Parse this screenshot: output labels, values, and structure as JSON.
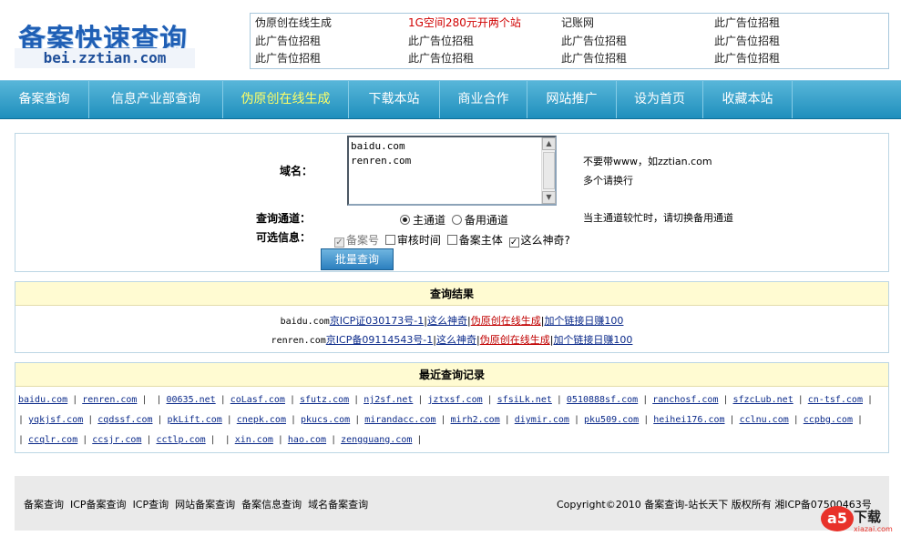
{
  "logo": {
    "title": "备案快速查询",
    "domain": "bei.zztian.com"
  },
  "ads": [
    [
      {
        "text": "伪原创在线生成",
        "red": false
      },
      {
        "text": "1G空间280元开两个站",
        "red": true
      },
      {
        "text": "记账网",
        "red": false
      },
      {
        "text": "此广告位招租",
        "red": false
      }
    ],
    [
      {
        "text": "此广告位招租",
        "red": false
      },
      {
        "text": "此广告位招租",
        "red": false
      },
      {
        "text": "此广告位招租",
        "red": false
      },
      {
        "text": "此广告位招租",
        "red": false
      }
    ],
    [
      {
        "text": "此广告位招租",
        "red": false
      },
      {
        "text": "此广告位招租",
        "red": false
      },
      {
        "text": "此广告位招租",
        "red": false
      },
      {
        "text": "此广告位招租",
        "red": false
      }
    ]
  ],
  "nav": [
    {
      "label": "备案查询",
      "active": false
    },
    {
      "label": "信息产业部查询",
      "active": false
    },
    {
      "label": "伪原创在线生成",
      "active": true
    },
    {
      "label": "下载本站",
      "active": false
    },
    {
      "label": "商业合作",
      "active": false
    },
    {
      "label": "网站推广",
      "active": false
    },
    {
      "label": "设为首页",
      "active": false
    },
    {
      "label": "收藏本站",
      "active": false
    }
  ],
  "form": {
    "domain_label": "域名：",
    "domain_value": "baidu.com\nrenren.com",
    "domain_note_1": "不要带www，如zztian.com",
    "domain_note_2": "多个请换行",
    "channel_label": "查询通道：",
    "channel_main": "主通道",
    "channel_backup": "备用通道",
    "channel_note": "当主通道较忙时，请切换备用通道",
    "options_label": "可选信息：",
    "opt_icp": "备案号",
    "opt_time": "审核时间",
    "opt_owner": "备案主体",
    "opt_magic": "这么神奇?",
    "submit": "批量查询"
  },
  "results": {
    "title": "查询结果",
    "rows": [
      {
        "domain": "baidu.com",
        "icp": "京ICP证030173号-1",
        "magic": "这么神奇",
        "fake": "伪原创在线生成",
        "earn": "加个链接日赚100"
      },
      {
        "domain": "renren.com",
        "icp": "京ICP备09114543号-1",
        "magic": "这么神奇",
        "fake": "伪原创在线生成",
        "earn": "加个链接日赚100"
      }
    ]
  },
  "recent": {
    "title": "最近查询记录",
    "lines": [
      [
        "baidu.com",
        "renren.com",
        "",
        "00635.net",
        "coLasf.com",
        "sfutz.com",
        "nj2sf.net",
        "jztxsf.com",
        "sfsiLk.net",
        "0510888sf.com",
        "ranchosf.com",
        "sfzcLub.net",
        "cn-tsf.com"
      ],
      [
        "yqkjsf.com",
        "cqdssf.com",
        "pkLift.com",
        "cnepk.com",
        "pkucs.com",
        "mirandacc.com",
        "mirh2.com",
        "diymir.com",
        "pku509.com",
        "heihei176.com",
        "cclnu.com",
        "ccpbg.com"
      ],
      [
        "ccqlr.com",
        "ccsjr.com",
        "cctlp.com",
        "",
        "xin.com",
        "hao.com",
        "zengguang.com"
      ]
    ]
  },
  "footer": {
    "links": [
      "备案查询",
      "ICP备案查询",
      "ICP查询",
      "网站备案查询",
      "备案信息查询",
      "域名备案查询"
    ],
    "copyright": "Copyright©2010 备案查询-站长天下 版权所有 湘ICP备07500463号"
  },
  "watermark": {
    "logo": "a5",
    "text": "下载",
    "sub": "xiazai.com"
  }
}
